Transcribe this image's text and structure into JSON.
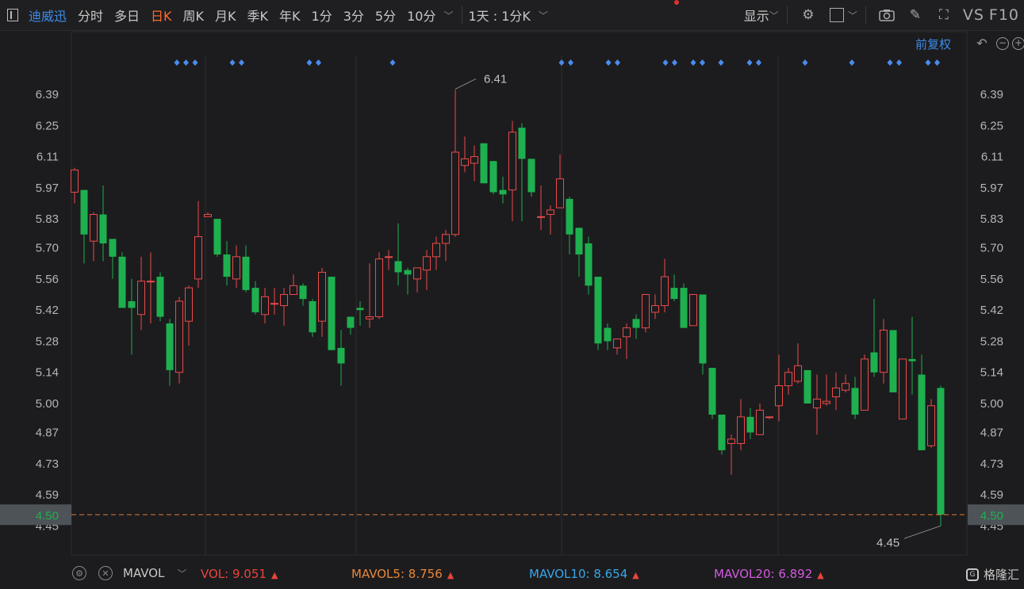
{
  "toolbar": {
    "stock_name": "迪威迅",
    "periods": [
      "分时",
      "多日",
      "日K",
      "周K",
      "月K",
      "季K",
      "年K",
      "1分",
      "3分",
      "5分",
      "10分"
    ],
    "active_period": "日K",
    "range": "1天 : 1分K",
    "display": "显示",
    "vs": "VS",
    "f10": "F10"
  },
  "adjust": "前复权",
  "chart_data": {
    "type": "candlestick",
    "y_ticks": [
      "6.39",
      "6.25",
      "6.11",
      "5.97",
      "5.83",
      "5.70",
      "5.56",
      "5.42",
      "5.28",
      "5.14",
      "5.00",
      "4.87",
      "4.73",
      "4.59",
      "4.45"
    ],
    "ylim": [
      4.41,
      6.5
    ],
    "current_price": "4.50",
    "high_label": "6.41",
    "low_label": "4.45",
    "colors": {
      "up": "#ec4a4a",
      "down": "#1eb04f",
      "price_line": "#e07a35",
      "marker": "#4a8cef"
    },
    "candles": [
      {
        "o": 5.95,
        "h": 6.06,
        "l": 5.9,
        "c": 6.05
      },
      {
        "o": 5.96,
        "h": 5.96,
        "l": 5.63,
        "c": 5.76
      },
      {
        "o": 5.73,
        "h": 5.86,
        "l": 5.64,
        "c": 5.85
      },
      {
        "o": 5.85,
        "h": 5.98,
        "l": 5.64,
        "c": 5.72
      },
      {
        "o": 5.74,
        "h": 5.74,
        "l": 5.56,
        "c": 5.66
      },
      {
        "o": 5.66,
        "h": 5.68,
        "l": 5.43,
        "c": 5.43
      },
      {
        "o": 5.46,
        "h": 5.56,
        "l": 5.22,
        "c": 5.43
      },
      {
        "o": 5.4,
        "h": 5.66,
        "l": 5.33,
        "c": 5.55
      },
      {
        "o": 5.55,
        "h": 5.68,
        "l": 5.36,
        "c": 5.55
      },
      {
        "o": 5.57,
        "h": 5.59,
        "l": 5.37,
        "c": 5.39
      },
      {
        "o": 5.36,
        "h": 5.38,
        "l": 5.08,
        "c": 5.15
      },
      {
        "o": 5.14,
        "h": 5.48,
        "l": 5.09,
        "c": 5.46
      },
      {
        "o": 5.37,
        "h": 5.53,
        "l": 5.26,
        "c": 5.52
      },
      {
        "o": 5.56,
        "h": 5.91,
        "l": 5.52,
        "c": 5.75
      },
      {
        "o": 5.84,
        "h": 5.86,
        "l": 5.84,
        "c": 5.85
      },
      {
        "o": 5.83,
        "h": 5.83,
        "l": 5.66,
        "c": 5.67
      },
      {
        "o": 5.67,
        "h": 5.73,
        "l": 5.53,
        "c": 5.57
      },
      {
        "o": 5.56,
        "h": 5.71,
        "l": 5.52,
        "c": 5.66
      },
      {
        "o": 5.66,
        "h": 5.71,
        "l": 5.5,
        "c": 5.51
      },
      {
        "o": 5.52,
        "h": 5.55,
        "l": 5.4,
        "c": 5.41
      },
      {
        "o": 5.4,
        "h": 5.52,
        "l": 5.36,
        "c": 5.48
      },
      {
        "o": 5.45,
        "h": 5.52,
        "l": 5.4,
        "c": 5.45
      },
      {
        "o": 5.44,
        "h": 5.52,
        "l": 5.35,
        "c": 5.49
      },
      {
        "o": 5.49,
        "h": 5.58,
        "l": 5.49,
        "c": 5.53
      },
      {
        "o": 5.53,
        "h": 5.54,
        "l": 5.44,
        "c": 5.47
      },
      {
        "o": 5.46,
        "h": 5.47,
        "l": 5.3,
        "c": 5.32
      },
      {
        "o": 5.37,
        "h": 5.61,
        "l": 5.3,
        "c": 5.59
      },
      {
        "o": 5.57,
        "h": 5.57,
        "l": 5.24,
        "c": 5.24
      },
      {
        "o": 5.25,
        "h": 5.33,
        "l": 5.08,
        "c": 5.18
      },
      {
        "o": 5.39,
        "h": 5.39,
        "l": 5.31,
        "c": 5.34
      },
      {
        "o": 5.43,
        "h": 5.46,
        "l": 5.35,
        "c": 5.42
      },
      {
        "o": 5.38,
        "h": 5.63,
        "l": 5.34,
        "c": 5.39
      },
      {
        "o": 5.39,
        "h": 5.68,
        "l": 5.38,
        "c": 5.65
      },
      {
        "o": 5.66,
        "h": 5.69,
        "l": 5.6,
        "c": 5.66
      },
      {
        "o": 5.64,
        "h": 5.81,
        "l": 5.53,
        "c": 5.59
      },
      {
        "o": 5.6,
        "h": 5.61,
        "l": 5.49,
        "c": 5.58
      },
      {
        "o": 5.56,
        "h": 5.61,
        "l": 5.5,
        "c": 5.61
      },
      {
        "o": 5.6,
        "h": 5.69,
        "l": 5.51,
        "c": 5.66
      },
      {
        "o": 5.66,
        "h": 5.75,
        "l": 5.6,
        "c": 5.72
      },
      {
        "o": 5.72,
        "h": 5.78,
        "l": 5.64,
        "c": 5.76
      },
      {
        "o": 5.76,
        "h": 6.41,
        "l": 5.75,
        "c": 6.13
      },
      {
        "o": 6.07,
        "h": 6.2,
        "l": 6.04,
        "c": 6.1
      },
      {
        "o": 6.08,
        "h": 6.16,
        "l": 6.0,
        "c": 6.11
      },
      {
        "o": 6.17,
        "h": 6.17,
        "l": 5.99,
        "c": 5.99
      },
      {
        "o": 6.09,
        "h": 6.09,
        "l": 5.94,
        "c": 5.95
      },
      {
        "o": 5.96,
        "h": 6.02,
        "l": 5.9,
        "c": 5.94
      },
      {
        "o": 5.96,
        "h": 6.27,
        "l": 5.82,
        "c": 6.22
      },
      {
        "o": 6.24,
        "h": 6.26,
        "l": 5.82,
        "c": 6.1
      },
      {
        "o": 6.1,
        "h": 6.1,
        "l": 5.93,
        "c": 5.95
      },
      {
        "o": 5.84,
        "h": 5.98,
        "l": 5.78,
        "c": 5.84
      },
      {
        "o": 5.85,
        "h": 5.89,
        "l": 5.76,
        "c": 5.87
      },
      {
        "o": 5.88,
        "h": 6.12,
        "l": 5.88,
        "c": 6.01
      },
      {
        "o": 5.92,
        "h": 5.93,
        "l": 5.67,
        "c": 5.76
      },
      {
        "o": 5.79,
        "h": 5.79,
        "l": 5.57,
        "c": 5.67
      },
      {
        "o": 5.72,
        "h": 5.75,
        "l": 5.49,
        "c": 5.53
      },
      {
        "o": 5.57,
        "h": 5.57,
        "l": 5.24,
        "c": 5.27
      },
      {
        "o": 5.34,
        "h": 5.36,
        "l": 5.24,
        "c": 5.28
      },
      {
        "o": 5.25,
        "h": 5.28,
        "l": 5.22,
        "c": 5.29
      },
      {
        "o": 5.3,
        "h": 5.36,
        "l": 5.2,
        "c": 5.34
      },
      {
        "o": 5.38,
        "h": 5.4,
        "l": 5.29,
        "c": 5.34
      },
      {
        "o": 5.34,
        "h": 5.49,
        "l": 5.32,
        "c": 5.49
      },
      {
        "o": 5.41,
        "h": 5.49,
        "l": 5.38,
        "c": 5.44
      },
      {
        "o": 5.44,
        "h": 5.65,
        "l": 5.41,
        "c": 5.57
      },
      {
        "o": 5.52,
        "h": 5.58,
        "l": 5.46,
        "c": 5.47
      },
      {
        "o": 5.52,
        "h": 5.54,
        "l": 5.34,
        "c": 5.34
      },
      {
        "o": 5.35,
        "h": 5.49,
        "l": 5.35,
        "c": 5.49
      },
      {
        "o": 5.49,
        "h": 5.49,
        "l": 5.13,
        "c": 5.18
      },
      {
        "o": 5.16,
        "h": 5.16,
        "l": 4.93,
        "c": 4.95
      },
      {
        "o": 4.95,
        "h": 4.95,
        "l": 4.77,
        "c": 4.79
      },
      {
        "o": 4.82,
        "h": 4.86,
        "l": 4.68,
        "c": 4.84
      },
      {
        "o": 4.82,
        "h": 5.02,
        "l": 4.79,
        "c": 4.94
      },
      {
        "o": 4.94,
        "h": 4.98,
        "l": 4.84,
        "c": 4.87
      },
      {
        "o": 4.86,
        "h": 5.0,
        "l": 4.86,
        "c": 4.97
      },
      {
        "o": 4.94,
        "h": 4.94,
        "l": 4.93,
        "c": 4.94
      },
      {
        "o": 4.99,
        "h": 5.22,
        "l": 4.92,
        "c": 5.08
      },
      {
        "o": 5.08,
        "h": 5.16,
        "l": 5.04,
        "c": 5.14
      },
      {
        "o": 5.1,
        "h": 5.27,
        "l": 5.09,
        "c": 5.17
      },
      {
        "o": 5.15,
        "h": 5.15,
        "l": 5.0,
        "c": 5.0
      },
      {
        "o": 4.98,
        "h": 5.13,
        "l": 4.86,
        "c": 5.02
      },
      {
        "o": 5.0,
        "h": 5.13,
        "l": 4.99,
        "c": 5.01
      },
      {
        "o": 5.03,
        "h": 5.14,
        "l": 4.97,
        "c": 5.07
      },
      {
        "o": 5.06,
        "h": 5.13,
        "l": 5.05,
        "c": 5.09
      },
      {
        "o": 5.07,
        "h": 5.12,
        "l": 4.93,
        "c": 4.95
      },
      {
        "o": 4.97,
        "h": 5.22,
        "l": 4.97,
        "c": 5.2
      },
      {
        "o": 5.23,
        "h": 5.47,
        "l": 5.12,
        "c": 5.14
      },
      {
        "o": 5.14,
        "h": 5.38,
        "l": 5.09,
        "c": 5.33
      },
      {
        "o": 5.33,
        "h": 5.33,
        "l": 5.05,
        "c": 5.05
      },
      {
        "o": 4.93,
        "h": 5.2,
        "l": 4.93,
        "c": 5.2
      },
      {
        "o": 5.2,
        "h": 5.39,
        "l": 5.04,
        "c": 5.19
      },
      {
        "o": 5.13,
        "h": 5.22,
        "l": 4.79,
        "c": 4.79
      },
      {
        "o": 4.81,
        "h": 5.02,
        "l": 4.8,
        "c": 4.99
      },
      {
        "o": 5.07,
        "h": 5.08,
        "l": 4.45,
        "c": 4.5
      }
    ],
    "marker_groups": [
      3,
      2,
      2,
      1,
      2,
      2,
      2,
      2,
      1,
      2,
      1,
      1,
      2,
      2
    ]
  },
  "volume_bar": {
    "indicator": "MAVOL",
    "vol": {
      "label": "VOL:",
      "value": "9.051",
      "color": "#e8453c"
    },
    "mavol5": {
      "label": "MAVOL5:",
      "value": "8.756",
      "color": "#e8873a"
    },
    "mavol10": {
      "label": "MAVOL10:",
      "value": "8.654",
      "color": "#3aa6e8"
    },
    "mavol20": {
      "label": "MAVOL20:",
      "value": "6.892",
      "color": "#d35ae0"
    }
  },
  "brand": "格隆汇"
}
